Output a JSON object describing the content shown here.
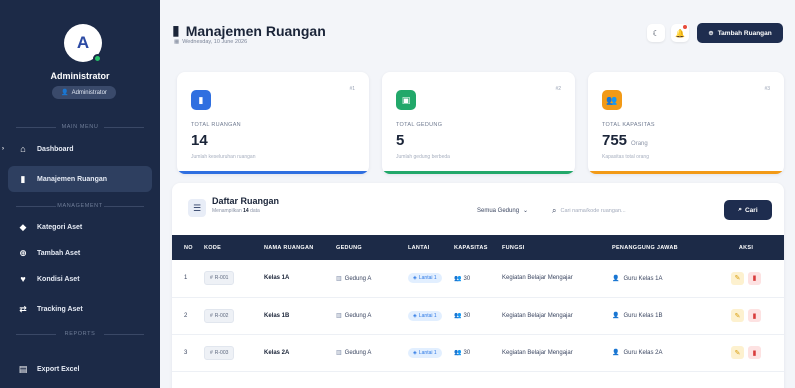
{
  "sidebar": {
    "avatar_letter": "A",
    "user_name": "Administrator",
    "role": "Administrator",
    "sections": {
      "main": "MAIN MENU",
      "management": "MANAGEMENT",
      "reports": "REPORTS"
    },
    "items": [
      {
        "label": "Dashboard",
        "icon": "home-icon"
      },
      {
        "label": "Manajemen Ruangan",
        "icon": "door-icon",
        "active": true
      },
      {
        "label": "Kategori Aset",
        "icon": "tag-icon"
      },
      {
        "label": "Tambah Aset",
        "icon": "plus-circle-icon"
      },
      {
        "label": "Kondisi Aset",
        "icon": "heart-icon"
      },
      {
        "label": "Tracking Aset",
        "icon": "route-icon"
      },
      {
        "label": "Export Excel",
        "icon": "file-excel-icon"
      }
    ]
  },
  "header": {
    "title": "Manajemen Ruangan",
    "date": "Wednesday, 10 June 2026",
    "add_button": "Tambah Ruangan"
  },
  "stats": [
    {
      "tag": "#1",
      "label": "TOTAL RUANGAN",
      "value": "14",
      "unit": "",
      "sub": "Jumlah keseluruhan ruangan",
      "color": "#2f6fe0",
      "icon": "door-icon"
    },
    {
      "tag": "#2",
      "label": "TOTAL GEDUNG",
      "value": "5",
      "unit": "",
      "sub": "Jumlah gedung berbeda",
      "color": "#22a86a",
      "icon": "building-icon"
    },
    {
      "tag": "#3",
      "label": "TOTAL KAPASITAS",
      "value": "755",
      "unit": "Orang",
      "sub": "Kapasitas total orang",
      "color": "#f29a17",
      "icon": "users-icon"
    }
  ],
  "table_panel": {
    "title": "Daftar Ruangan",
    "subtitle_prefix": "Menampilkan",
    "subtitle_count": "14",
    "subtitle_suffix": "data",
    "filter_value": "Semua Gedung",
    "search_placeholder": "Cari nama/kode ruangan...",
    "search_button": "Cari",
    "columns": [
      "NO",
      "KODE",
      "NAMA RUANGAN",
      "GEDUNG",
      "LANTAI",
      "KAPASITAS",
      "FUNGSI",
      "PENANGGUNG JAWAB",
      "AKSI"
    ],
    "rows": [
      {
        "no": "1",
        "kode": "R-001",
        "nama": "Kelas 1A",
        "gedung": "Gedung A",
        "lantai": "Lantai 1",
        "kapasitas": "30",
        "fungsi": "Kegiatan Belajar Mengajar",
        "pj": "Guru Kelas 1A"
      },
      {
        "no": "2",
        "kode": "R-002",
        "nama": "Kelas 1B",
        "gedung": "Gedung A",
        "lantai": "Lantai 1",
        "kapasitas": "30",
        "fungsi": "Kegiatan Belajar Mengajar",
        "pj": "Guru Kelas 1B"
      },
      {
        "no": "3",
        "kode": "R-003",
        "nama": "Kelas 2A",
        "gedung": "Gedung A",
        "lantai": "Lantai 1",
        "kapasitas": "30",
        "fungsi": "Kegiatan Belajar Mengajar",
        "pj": "Guru Kelas 2A"
      }
    ]
  }
}
